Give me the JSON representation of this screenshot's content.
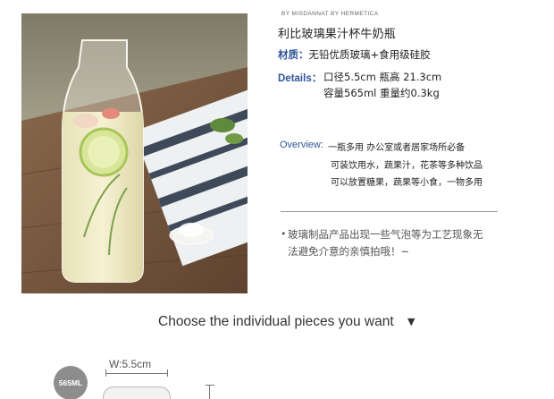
{
  "product": {
    "brand": "BY MISDANNAT BY HERMETICA",
    "title": "利比玻璃果汁杯牛奶瓶",
    "material_label": "材质：",
    "material_value": "无铅优质玻璃+食用级硅胶",
    "details_label": "Details：",
    "details_line1": "口径5.5cm 瓶高 21.3cm",
    "details_line2": "容量565ml 重量约0.3kg",
    "overview_label": "Overview:",
    "overview_line1": "一瓶多用 办公室或者居家场所必备",
    "overview_line2": "可装饮用水，蔬果汁，花茶等多种饮品",
    "overview_line3": "可以放置糖果，蔬果等小食，一物多用",
    "note_bullet": "•",
    "note_line1": "玻璃制品产品出现一些气泡等为工艺现象无",
    "note_line2": "法避免介意的亲慎拍哦！~"
  },
  "selector": {
    "label": "Choose the individual pieces you want",
    "arrow": "▼"
  },
  "diagram": {
    "capacity_badge": "565ML",
    "width_label": "W:5.5cm"
  },
  "colors": {
    "accent_blue": "#2f5597",
    "badge_gray": "#8d8d8d"
  }
}
